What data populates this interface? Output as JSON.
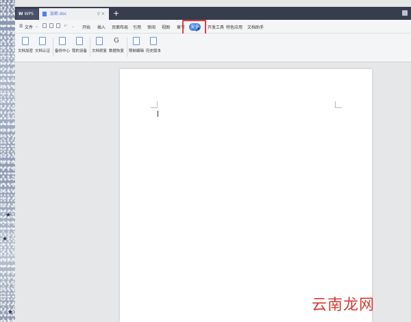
{
  "titlebar": {
    "app_tab": "WPS",
    "doc_tab": "加密.doc",
    "new_tab": "+"
  },
  "menubar": {
    "file_menu": "文件",
    "items": [
      "开始",
      "插入",
      "页面布局",
      "引用",
      "审阅",
      "视图",
      "章节",
      "安全",
      "开发工具",
      "特色应用",
      "文档助手"
    ],
    "active_item": "安全"
  },
  "ribbon": {
    "groups": [
      [
        "文档加密",
        "文档认证"
      ],
      [
        "备份中心",
        "我的设备"
      ],
      [
        "文档修复",
        "数据恢复"
      ],
      [
        "限制编辑",
        "历史版本"
      ]
    ]
  },
  "watermark": "云南龙网",
  "colors": {
    "accent": "#4a86e8",
    "highlight": "#e43c3c",
    "tabbar": "#383d4d"
  }
}
